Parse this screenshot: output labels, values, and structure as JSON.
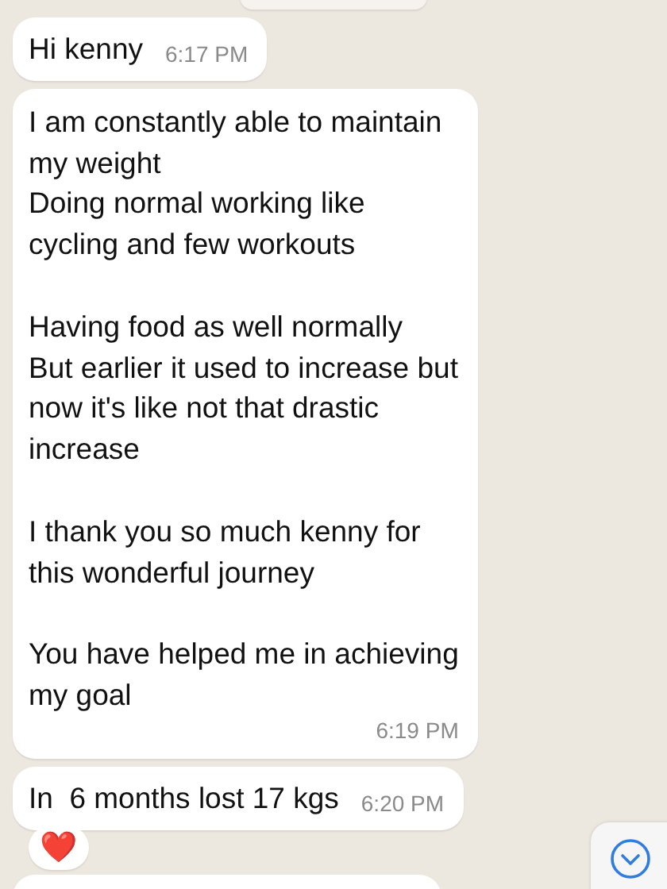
{
  "date_chip": {
    "kind": "cut"
  },
  "messages": [
    {
      "text": "Hi kenny",
      "time": "6:17 PM"
    },
    {
      "text": "I am constantly able to maintain\nmy weight\nDoing normal working like\ncycling and few workouts\n\nHaving food as well normally\nBut earlier it used to increase but\nnow it's like not that drastic\nincrease\n\nI thank you so much kenny for\nthis wonderful journey\n\nYou have helped me in achieving\nmy goal",
      "time": "6:19 PM"
    },
    {
      "text": "In  6 months lost 17 kgs",
      "time": "6:20 PM",
      "reaction": "❤️"
    }
  ],
  "next_bubble": {
    "kind": "cut"
  },
  "scroll_down_button": {
    "kind": "chevron"
  }
}
